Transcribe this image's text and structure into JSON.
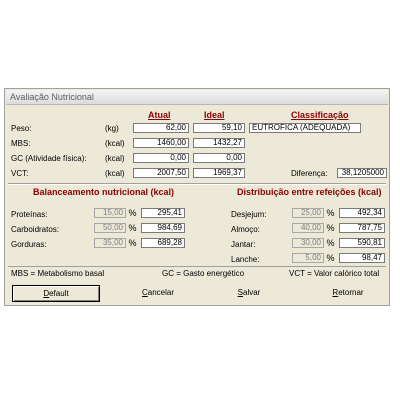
{
  "window": {
    "title": "Avaliação Nutricional"
  },
  "headers": {
    "atual": "Atual",
    "ideal": "Ideal",
    "classificacao": "Classificação"
  },
  "rows": [
    {
      "label": "Peso:",
      "unit": "(kg)",
      "atual": "62,00",
      "ideal": "59,10"
    },
    {
      "label": "MBS:",
      "unit": "(kcal)",
      "atual": "1460,00",
      "ideal": "1432,27"
    },
    {
      "label": "GC (Atividade física):",
      "unit": "(kcal)",
      "atual": "0,00",
      "ideal": "0,00"
    },
    {
      "label": "VCT:",
      "unit": "(kcal)",
      "atual": "2007,50",
      "ideal": "1969,37"
    }
  ],
  "classification": {
    "value": "EUTRÓFICA (ADEQUADA)"
  },
  "difference": {
    "label": "Diferença:",
    "value": "38,1205000"
  },
  "balance": {
    "title": "Balanceamento nutricional (kcal)",
    "items": [
      {
        "label": "Proteínas:",
        "pct": "15,00",
        "pct_sign": "%",
        "kcal": "295,41"
      },
      {
        "label": "Carboidratos:",
        "pct": "50,00",
        "pct_sign": "%",
        "kcal": "984,69"
      },
      {
        "label": "Gorduras:",
        "pct": "35,00",
        "pct_sign": "%",
        "kcal": "689,28"
      }
    ]
  },
  "meals": {
    "title": "Distribuição entre refeições (kcal)",
    "items": [
      {
        "label": "Desjejum:",
        "pct": "25,00",
        "pct_sign": "%",
        "kcal": "492,34"
      },
      {
        "label": "Almoço:",
        "pct": "40,00",
        "pct_sign": "%",
        "kcal": "787,75"
      },
      {
        "label": "Jantar:",
        "pct": "30,00",
        "pct_sign": "%",
        "kcal": "590,81"
      },
      {
        "label": "Lanche:",
        "pct": "5,00",
        "pct_sign": "%",
        "kcal": "98,47"
      }
    ]
  },
  "legend": {
    "mbs": "MBS = Metabolismo basal",
    "gc": "GC = Gasto energético",
    "vct": "VCT = Valor calórico total"
  },
  "buttons": {
    "default": {
      "first": "D",
      "rest": "efault"
    },
    "cancelar": {
      "first": "C",
      "rest": "ancelar"
    },
    "salvar": {
      "first": "S",
      "rest": "alvar"
    },
    "retornar": {
      "first": "R",
      "rest": "etornar"
    }
  },
  "icons": {
    "spin": "spin-updown-icon"
  }
}
